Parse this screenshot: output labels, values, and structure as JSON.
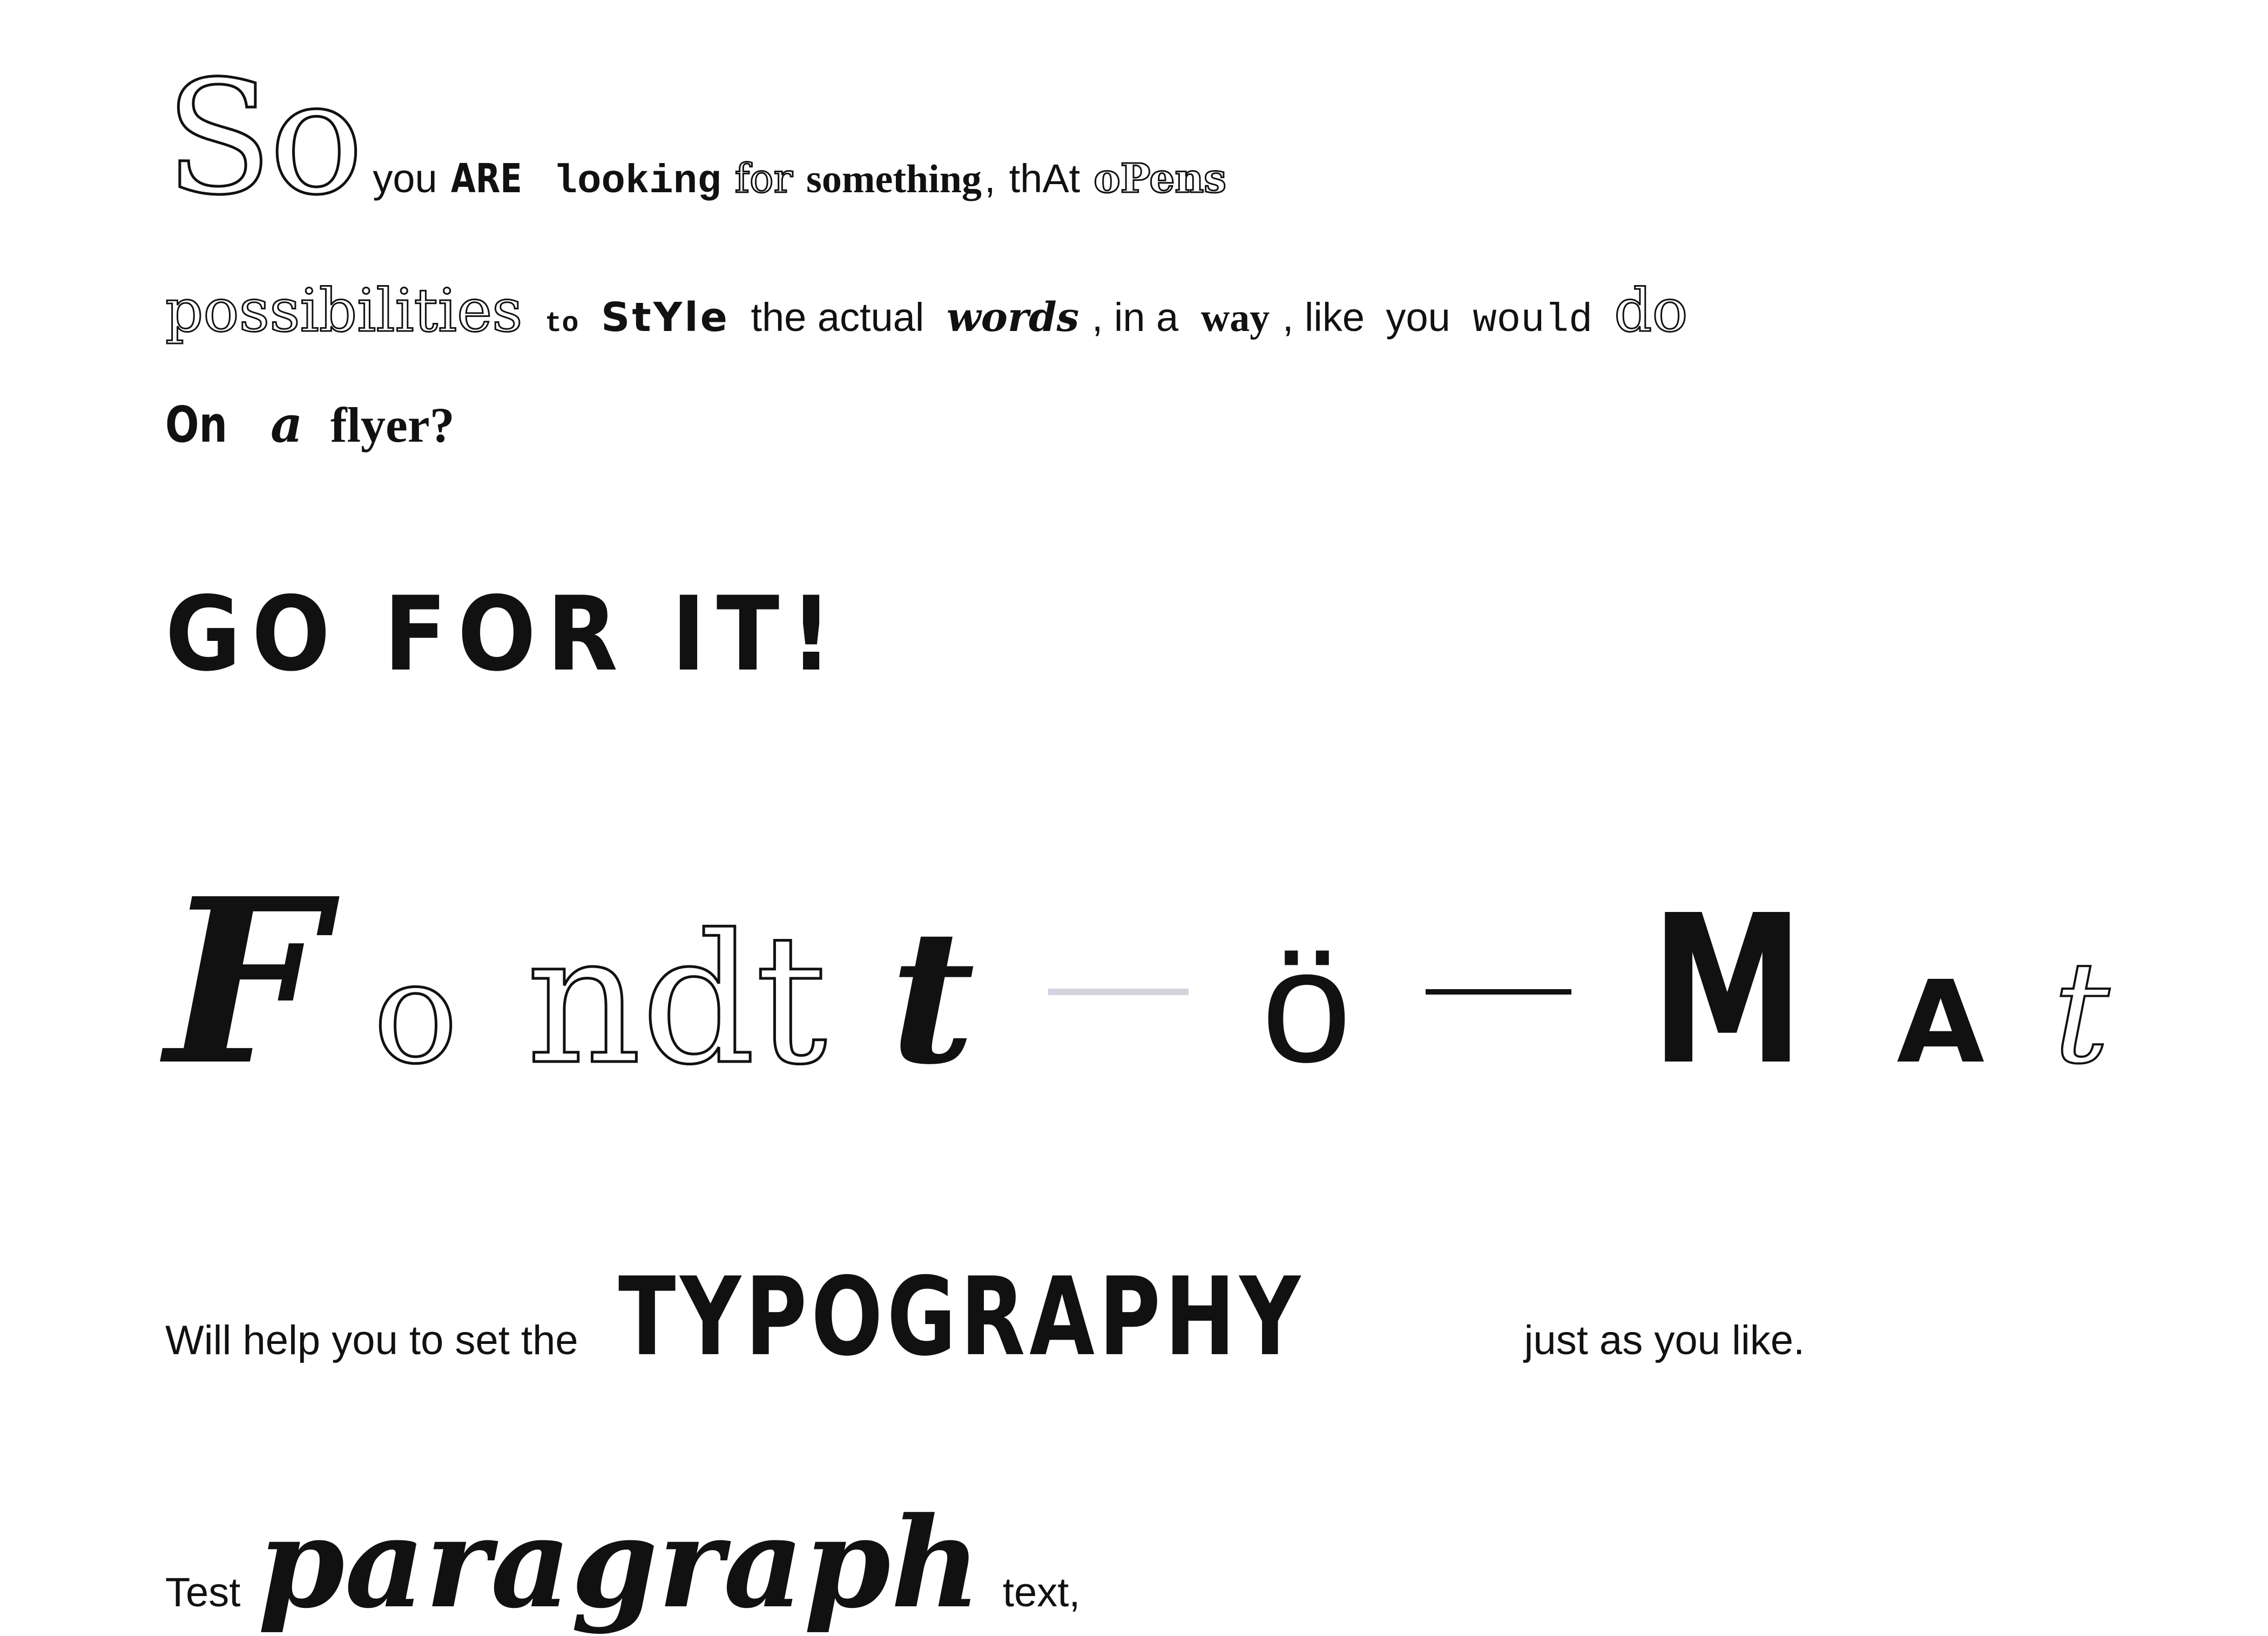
{
  "lines": {
    "l1": {
      "w1": "So",
      "w2": "you",
      "w3": "ARE",
      "w4": "looking",
      "w5": "for",
      "w6": "something",
      "w7": ",",
      "w8": "thAt",
      "w9": "oPens"
    },
    "l2": {
      "w1": "possibilities",
      "w2": "to",
      "w3": "StYle",
      "w4": "the actual",
      "w5": "words",
      "w6": ", in a",
      "w7": "way",
      "w8": ", like",
      "w9": "you",
      "w10": "would",
      "w11": "do"
    },
    "l3": {
      "w1": "On",
      "w2": "a",
      "w3": "flyer?"
    },
    "l4": {
      "w1": "GO FOR IT!"
    },
    "l5": {
      "f": "F",
      "o": "o",
      "ndt": "ndt",
      "t2": "t",
      "o_umlaut": "ö",
      "m": "M",
      "a": "A",
      "t3": "t"
    },
    "l6": {
      "w1": "Will help you to set the",
      "w2": "TYPOGRAPHY",
      "w3": "just as you like."
    },
    "l7": {
      "w1": "Test",
      "w2": "paragraph",
      "w3": "text,"
    }
  }
}
